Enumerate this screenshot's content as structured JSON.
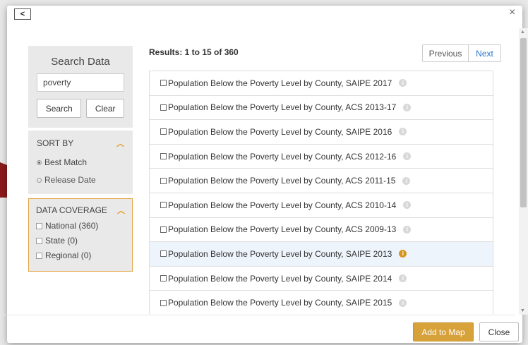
{
  "header": {
    "back_icon": "chevron-left-icon",
    "back_glyph": "<",
    "close_glyph": "×"
  },
  "search": {
    "title": "Search Data",
    "query": "poverty",
    "search_label": "Search",
    "clear_label": "Clear"
  },
  "sort": {
    "heading": "SORT BY",
    "options": [
      {
        "label": "Best Match",
        "selected": true
      },
      {
        "label": "Release Date",
        "selected": false
      }
    ]
  },
  "coverage": {
    "heading": "DATA COVERAGE",
    "options": [
      {
        "label": "National (360)",
        "checked": false
      },
      {
        "label": "State (0)",
        "checked": false
      },
      {
        "label": "Regional (0)",
        "checked": false
      }
    ]
  },
  "results": {
    "summary": "Results: 1 to 15 of 360",
    "prev_label": "Previous",
    "next_label": "Next",
    "items": [
      {
        "label": "Population Below the Poverty Level by County, SAIPE 2017",
        "highlighted": false
      },
      {
        "label": "Population Below the Poverty Level by County, ACS 2013-17",
        "highlighted": false
      },
      {
        "label": "Population Below the Poverty Level by County, SAIPE 2016",
        "highlighted": false
      },
      {
        "label": "Population Below the Poverty Level by County, ACS 2012-16",
        "highlighted": false
      },
      {
        "label": "Population Below the Poverty Level by County, ACS 2011-15",
        "highlighted": false
      },
      {
        "label": "Population Below the Poverty Level by County, ACS 2010-14",
        "highlighted": false
      },
      {
        "label": "Population Below the Poverty Level by County, ACS 2009-13",
        "highlighted": false
      },
      {
        "label": "Population Below the Poverty Level by County, SAIPE 2013",
        "highlighted": true
      },
      {
        "label": "Population Below the Poverty Level by County, SAIPE 2014",
        "highlighted": false
      },
      {
        "label": "Population Below the Poverty Level by County, SAIPE 2015",
        "highlighted": false
      }
    ]
  },
  "footer": {
    "add_label": "Add to Map",
    "close_label": "Close"
  },
  "colors": {
    "accent": "#d8a23a",
    "link": "#2a74c9",
    "panel": "#e9e9e9"
  }
}
